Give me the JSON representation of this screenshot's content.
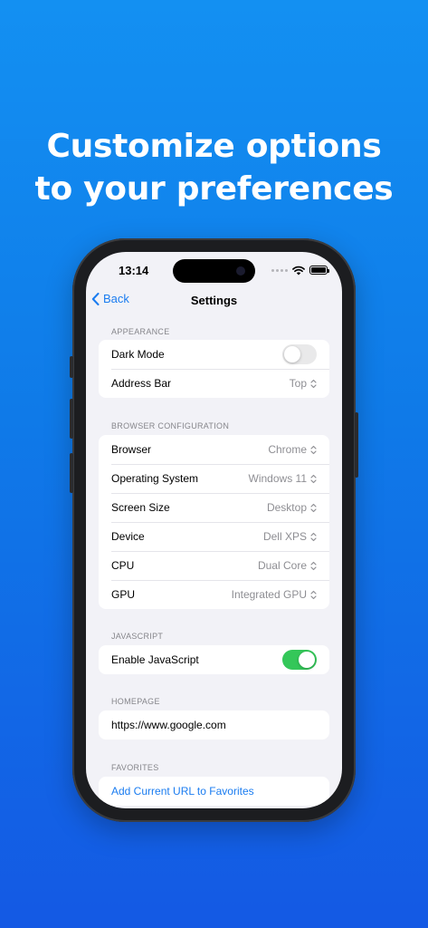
{
  "headline": {
    "line1": "Customize options",
    "line2": "to your preferences"
  },
  "status": {
    "time": "13:14"
  },
  "nav": {
    "back_label": "Back",
    "title": "Settings"
  },
  "sections": {
    "appearance": {
      "header": "APPEARANCE",
      "dark_mode": {
        "label": "Dark Mode",
        "on": false
      },
      "address_bar": {
        "label": "Address Bar",
        "value": "Top"
      }
    },
    "browser_config": {
      "header": "BROWSER CONFIGURATION",
      "rows": [
        {
          "label": "Browser",
          "value": "Chrome"
        },
        {
          "label": "Operating System",
          "value": "Windows 11"
        },
        {
          "label": "Screen Size",
          "value": "Desktop"
        },
        {
          "label": "Device",
          "value": "Dell XPS"
        },
        {
          "label": "CPU",
          "value": "Dual Core"
        },
        {
          "label": "GPU",
          "value": "Integrated GPU"
        }
      ]
    },
    "javascript": {
      "header": "JAVASCRIPT",
      "enable": {
        "label": "Enable JavaScript",
        "on": true
      }
    },
    "homepage": {
      "header": "HOMEPAGE",
      "url": "https://www.google.com"
    },
    "favorites": {
      "header": "FAVORITES",
      "add_label": "Add Current URL to Favorites"
    }
  },
  "colors": {
    "accent": "#1a7cf0",
    "toggle_on": "#34c759",
    "background_top": "#1390f2",
    "background_bottom": "#1459e4"
  },
  "icons": [
    "chevron-left-icon",
    "up-down-chevron-icon",
    "wifi-icon",
    "battery-icon",
    "signal-dots-icon"
  ]
}
